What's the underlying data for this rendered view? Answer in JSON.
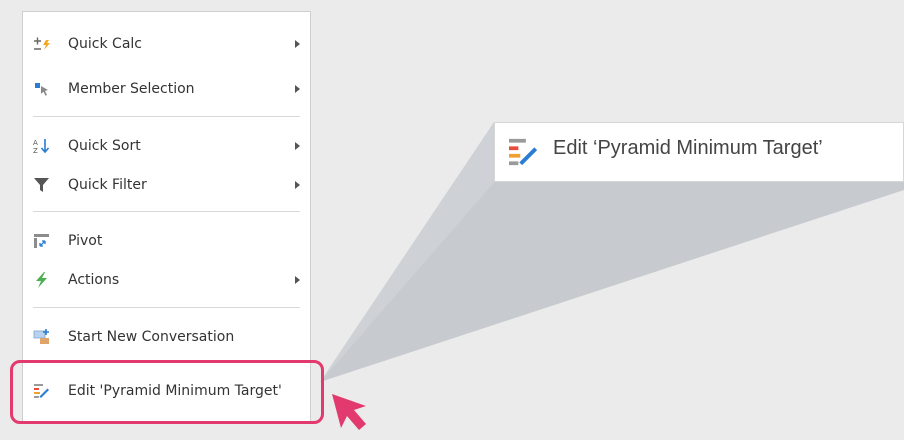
{
  "menu": {
    "items": [
      {
        "label": "Quick Calc",
        "icon": "quick-calc-icon",
        "submenu": true
      },
      {
        "label": "Member Selection",
        "icon": "member-selection-icon",
        "submenu": true
      },
      {
        "label": "Quick Sort",
        "icon": "quick-sort-icon",
        "submenu": true
      },
      {
        "label": "Quick Filter",
        "icon": "filter-icon",
        "submenu": true
      },
      {
        "label": "Pivot",
        "icon": "pivot-icon",
        "submenu": false
      },
      {
        "label": "Actions",
        "icon": "actions-icon",
        "submenu": true
      },
      {
        "label": "Start New Conversation",
        "icon": "new-conversation-icon",
        "submenu": false
      },
      {
        "label": "Edit 'Pyramid Minimum Target'",
        "icon": "edit-target-icon",
        "submenu": false
      }
    ]
  },
  "zoom": {
    "label": "Edit ‘Pyramid Minimum Target’",
    "icon": "edit-target-icon"
  },
  "colors": {
    "highlight": "#e23a6e",
    "quick_calc_orange": "#f5a623",
    "actions_green": "#4caf50",
    "accent_blue": "#2b7cd3"
  }
}
